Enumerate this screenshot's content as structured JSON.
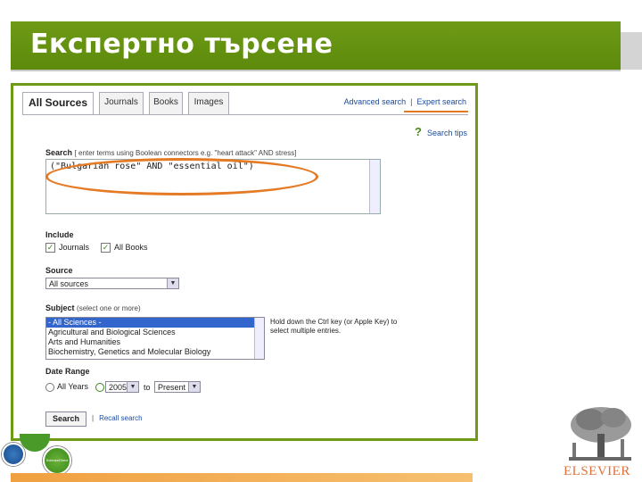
{
  "slide": {
    "title": "Експертно търсене",
    "publisher_logo_text": "ELSEVIER",
    "badge_text": "ScienceDirect"
  },
  "tabs": [
    "All Sources",
    "Journals",
    "Books",
    "Images"
  ],
  "top_links": {
    "advanced": "Advanced search",
    "expert": "Expert search"
  },
  "search_tips": "Search tips",
  "search": {
    "label": "Search",
    "hint": "[ enter terms using Boolean connectors e.g. \"heart attack\" AND stress]",
    "query": "(\"Bulgarian rose\" AND \"essential oil\")"
  },
  "include": {
    "label": "Include",
    "options": [
      "Journals",
      "All Books"
    ]
  },
  "source": {
    "label": "Source",
    "selected": "All sources"
  },
  "subject": {
    "label": "Subject",
    "hint": "(select one or more)",
    "items": [
      "- All Sciences -",
      "Agricultural and Biological Sciences",
      "Arts and Humanities",
      "Biochemistry, Genetics and Molecular Biology"
    ],
    "help": "Hold down the Ctrl key (or Apple Key) to select multiple entries."
  },
  "date_range": {
    "label": "Date Range",
    "all_years": "All Years",
    "from": "2005",
    "to_label": "to",
    "to": "Present"
  },
  "buttons": {
    "search": "Search",
    "recall": "Recall search"
  },
  "colors": {
    "banner": "#6e9a17",
    "highlight": "#e57a24",
    "link": "#1a4a9c"
  }
}
